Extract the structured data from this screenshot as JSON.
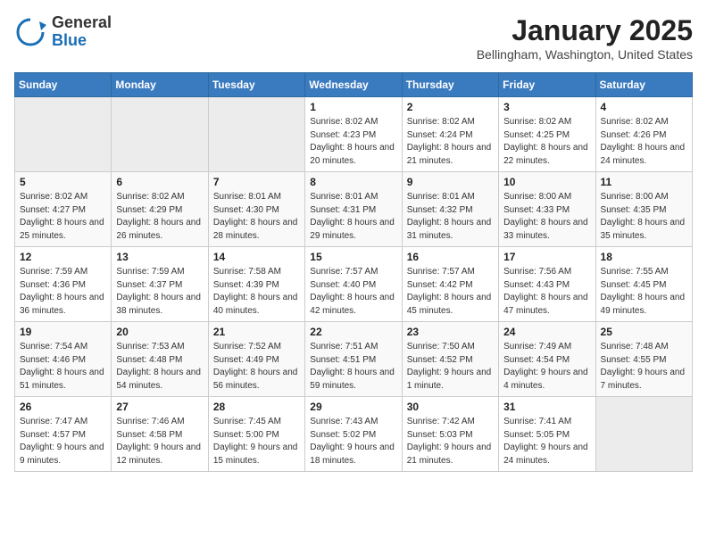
{
  "header": {
    "logo_general": "General",
    "logo_blue": "Blue",
    "month_title": "January 2025",
    "location": "Bellingham, Washington, United States"
  },
  "weekdays": [
    "Sunday",
    "Monday",
    "Tuesday",
    "Wednesday",
    "Thursday",
    "Friday",
    "Saturday"
  ],
  "weeks": [
    [
      {
        "day": "",
        "sunrise": "",
        "sunset": "",
        "daylight": "",
        "empty": true
      },
      {
        "day": "",
        "sunrise": "",
        "sunset": "",
        "daylight": "",
        "empty": true
      },
      {
        "day": "",
        "sunrise": "",
        "sunset": "",
        "daylight": "",
        "empty": true
      },
      {
        "day": "1",
        "sunrise": "8:02 AM",
        "sunset": "4:23 PM",
        "daylight": "8 hours and 20 minutes.",
        "empty": false
      },
      {
        "day": "2",
        "sunrise": "8:02 AM",
        "sunset": "4:24 PM",
        "daylight": "8 hours and 21 minutes.",
        "empty": false
      },
      {
        "day": "3",
        "sunrise": "8:02 AM",
        "sunset": "4:25 PM",
        "daylight": "8 hours and 22 minutes.",
        "empty": false
      },
      {
        "day": "4",
        "sunrise": "8:02 AM",
        "sunset": "4:26 PM",
        "daylight": "8 hours and 24 minutes.",
        "empty": false
      }
    ],
    [
      {
        "day": "5",
        "sunrise": "8:02 AM",
        "sunset": "4:27 PM",
        "daylight": "8 hours and 25 minutes.",
        "empty": false
      },
      {
        "day": "6",
        "sunrise": "8:02 AM",
        "sunset": "4:29 PM",
        "daylight": "8 hours and 26 minutes.",
        "empty": false
      },
      {
        "day": "7",
        "sunrise": "8:01 AM",
        "sunset": "4:30 PM",
        "daylight": "8 hours and 28 minutes.",
        "empty": false
      },
      {
        "day": "8",
        "sunrise": "8:01 AM",
        "sunset": "4:31 PM",
        "daylight": "8 hours and 29 minutes.",
        "empty": false
      },
      {
        "day": "9",
        "sunrise": "8:01 AM",
        "sunset": "4:32 PM",
        "daylight": "8 hours and 31 minutes.",
        "empty": false
      },
      {
        "day": "10",
        "sunrise": "8:00 AM",
        "sunset": "4:33 PM",
        "daylight": "8 hours and 33 minutes.",
        "empty": false
      },
      {
        "day": "11",
        "sunrise": "8:00 AM",
        "sunset": "4:35 PM",
        "daylight": "8 hours and 35 minutes.",
        "empty": false
      }
    ],
    [
      {
        "day": "12",
        "sunrise": "7:59 AM",
        "sunset": "4:36 PM",
        "daylight": "8 hours and 36 minutes.",
        "empty": false
      },
      {
        "day": "13",
        "sunrise": "7:59 AM",
        "sunset": "4:37 PM",
        "daylight": "8 hours and 38 minutes.",
        "empty": false
      },
      {
        "day": "14",
        "sunrise": "7:58 AM",
        "sunset": "4:39 PM",
        "daylight": "8 hours and 40 minutes.",
        "empty": false
      },
      {
        "day": "15",
        "sunrise": "7:57 AM",
        "sunset": "4:40 PM",
        "daylight": "8 hours and 42 minutes.",
        "empty": false
      },
      {
        "day": "16",
        "sunrise": "7:57 AM",
        "sunset": "4:42 PM",
        "daylight": "8 hours and 45 minutes.",
        "empty": false
      },
      {
        "day": "17",
        "sunrise": "7:56 AM",
        "sunset": "4:43 PM",
        "daylight": "8 hours and 47 minutes.",
        "empty": false
      },
      {
        "day": "18",
        "sunrise": "7:55 AM",
        "sunset": "4:45 PM",
        "daylight": "8 hours and 49 minutes.",
        "empty": false
      }
    ],
    [
      {
        "day": "19",
        "sunrise": "7:54 AM",
        "sunset": "4:46 PM",
        "daylight": "8 hours and 51 minutes.",
        "empty": false
      },
      {
        "day": "20",
        "sunrise": "7:53 AM",
        "sunset": "4:48 PM",
        "daylight": "8 hours and 54 minutes.",
        "empty": false
      },
      {
        "day": "21",
        "sunrise": "7:52 AM",
        "sunset": "4:49 PM",
        "daylight": "8 hours and 56 minutes.",
        "empty": false
      },
      {
        "day": "22",
        "sunrise": "7:51 AM",
        "sunset": "4:51 PM",
        "daylight": "8 hours and 59 minutes.",
        "empty": false
      },
      {
        "day": "23",
        "sunrise": "7:50 AM",
        "sunset": "4:52 PM",
        "daylight": "9 hours and 1 minute.",
        "empty": false
      },
      {
        "day": "24",
        "sunrise": "7:49 AM",
        "sunset": "4:54 PM",
        "daylight": "9 hours and 4 minutes.",
        "empty": false
      },
      {
        "day": "25",
        "sunrise": "7:48 AM",
        "sunset": "4:55 PM",
        "daylight": "9 hours and 7 minutes.",
        "empty": false
      }
    ],
    [
      {
        "day": "26",
        "sunrise": "7:47 AM",
        "sunset": "4:57 PM",
        "daylight": "9 hours and 9 minutes.",
        "empty": false
      },
      {
        "day": "27",
        "sunrise": "7:46 AM",
        "sunset": "4:58 PM",
        "daylight": "9 hours and 12 minutes.",
        "empty": false
      },
      {
        "day": "28",
        "sunrise": "7:45 AM",
        "sunset": "5:00 PM",
        "daylight": "9 hours and 15 minutes.",
        "empty": false
      },
      {
        "day": "29",
        "sunrise": "7:43 AM",
        "sunset": "5:02 PM",
        "daylight": "9 hours and 18 minutes.",
        "empty": false
      },
      {
        "day": "30",
        "sunrise": "7:42 AM",
        "sunset": "5:03 PM",
        "daylight": "9 hours and 21 minutes.",
        "empty": false
      },
      {
        "day": "31",
        "sunrise": "7:41 AM",
        "sunset": "5:05 PM",
        "daylight": "9 hours and 24 minutes.",
        "empty": false
      },
      {
        "day": "",
        "sunrise": "",
        "sunset": "",
        "daylight": "",
        "empty": true
      }
    ]
  ],
  "labels": {
    "sunrise_prefix": "Sunrise: ",
    "sunset_prefix": "Sunset: ",
    "daylight_prefix": "Daylight: "
  }
}
